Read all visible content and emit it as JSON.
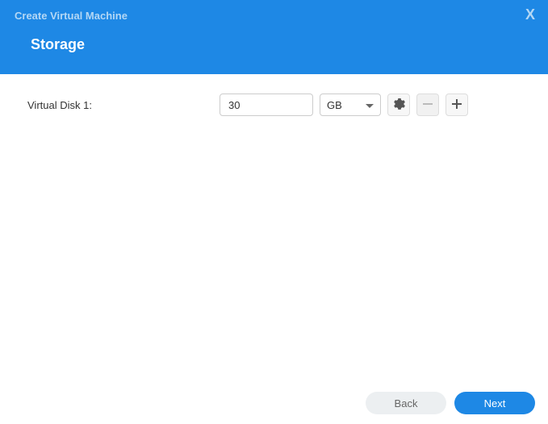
{
  "header": {
    "title": "Create Virtual Machine",
    "subtitle": "Storage",
    "close_label": "X"
  },
  "storage": {
    "disk_label": "Virtual Disk 1:",
    "size_value": "30",
    "unit_value": "GB"
  },
  "footer": {
    "back_label": "Back",
    "next_label": "Next"
  },
  "icons": {
    "gear": "gear-icon",
    "minus": "minus-icon",
    "plus": "plus-icon",
    "close": "close-icon",
    "caret": "caret-down-icon"
  }
}
